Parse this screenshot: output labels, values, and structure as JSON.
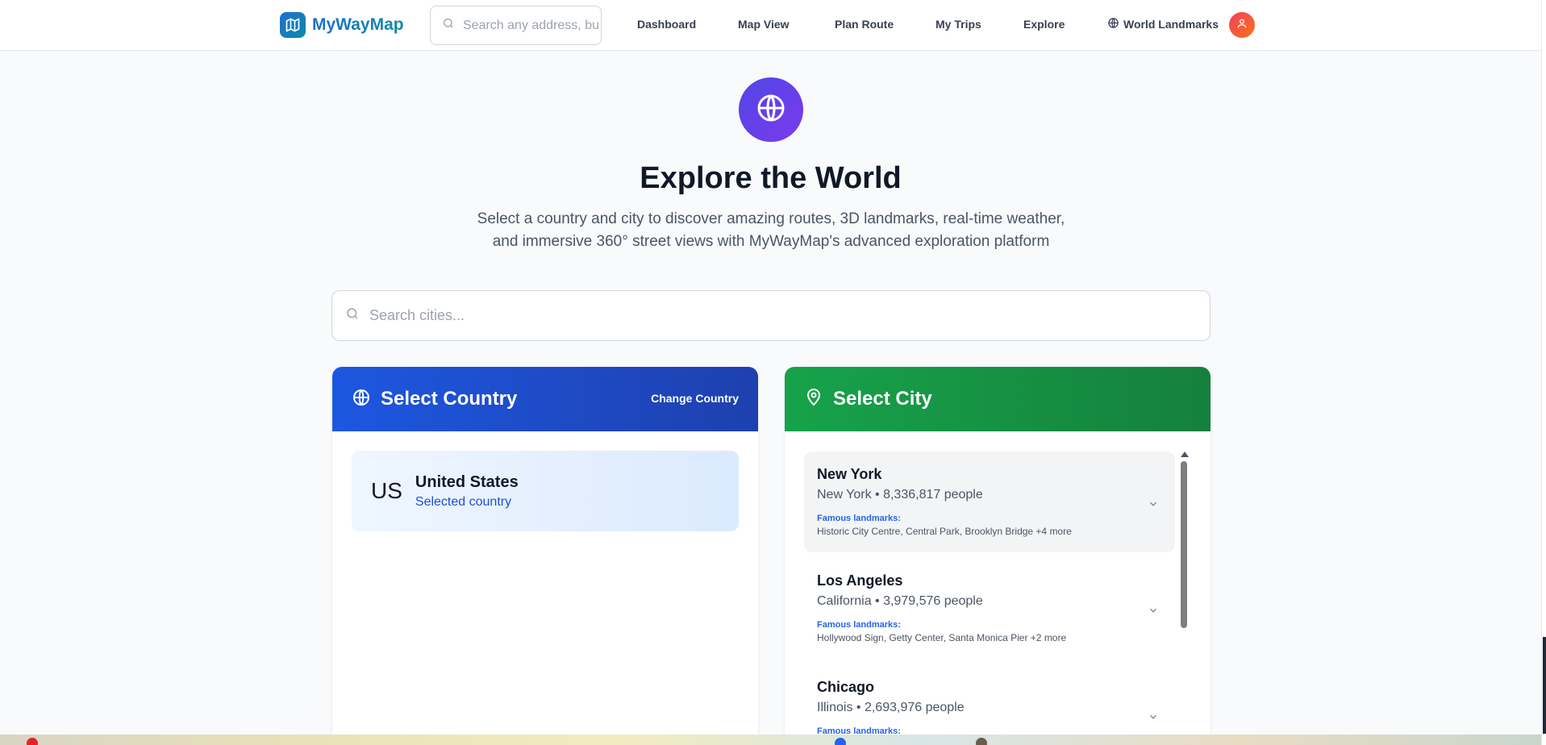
{
  "nav": {
    "brand": "MyWayMap",
    "search_placeholder": "Search any address, bu",
    "links": [
      "Dashboard",
      "Map View",
      "Plan Route",
      "My Trips",
      "Explore",
      "World Landmarks"
    ]
  },
  "hero": {
    "title": "Explore the World",
    "subtitle_line1": "Select a country and city to discover amazing routes, 3D landmarks, real-time weather,",
    "subtitle_line2": "and immersive 360° street views with MyWayMap's advanced exploration platform"
  },
  "city_search": {
    "placeholder": "Search cities..."
  },
  "country_panel": {
    "title": "Select Country",
    "change_label": "Change Country",
    "selected": {
      "code": "US",
      "name": "United States",
      "status": "Selected country"
    }
  },
  "city_panel": {
    "title": "Select City",
    "landmarks_label": "Famous landmarks:",
    "cities": [
      {
        "name": "New York",
        "meta": "New York • 8,336,817 people",
        "landmarks": "Historic City Centre, Central Park, Brooklyn Bridge +4 more"
      },
      {
        "name": "Los Angeles",
        "meta": "California • 3,979,576 people",
        "landmarks": "Hollywood Sign, Getty Center, Santa Monica Pier +2 more"
      },
      {
        "name": "Chicago",
        "meta": "Illinois • 2,693,976 people",
        "landmarks": ""
      }
    ]
  },
  "colors": {
    "country_header": "#1d57e0",
    "city_header": "#16a34a",
    "brand": "#1d6fd0",
    "hero_icon": "#6d4ae8",
    "avatar": "#f43f5e"
  },
  "icons": {
    "logo": "map-icon",
    "search": "search-icon",
    "globe": "globe-icon",
    "pin": "map-pin-icon",
    "user": "user-icon",
    "chevron": "chevron-down-icon"
  }
}
